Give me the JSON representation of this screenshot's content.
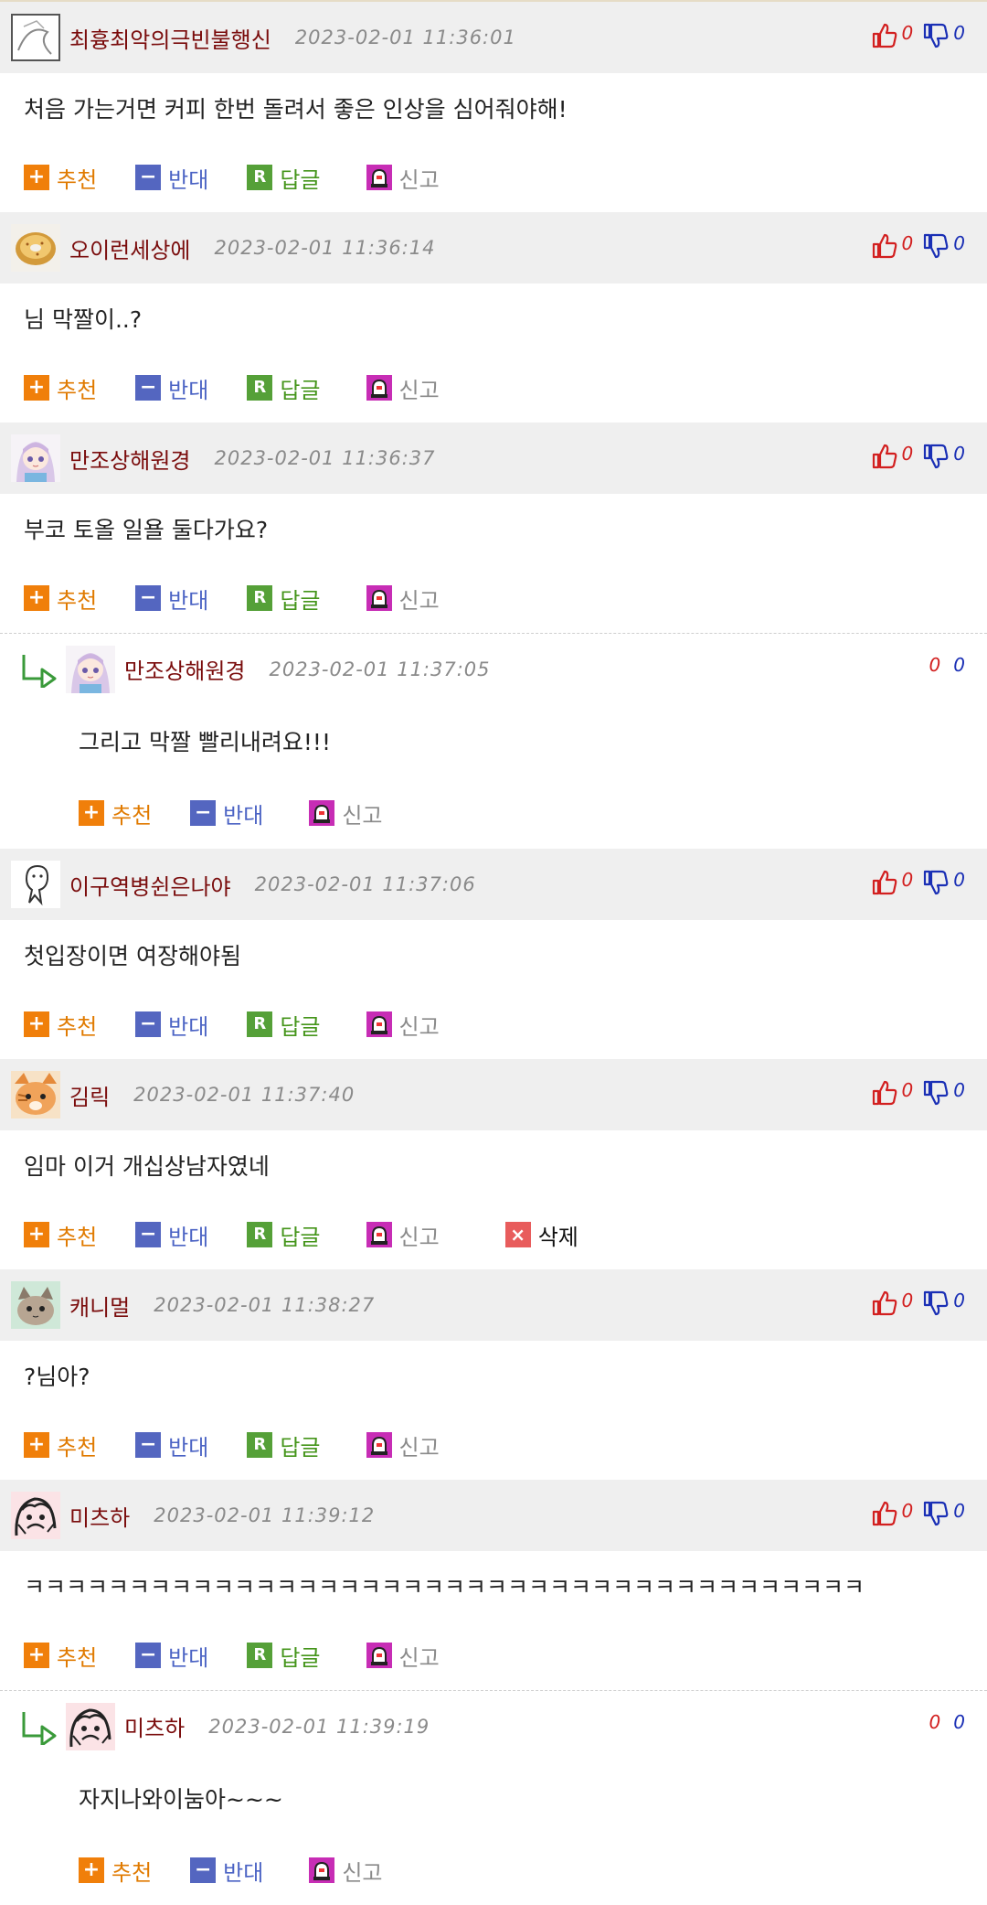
{
  "labels": {
    "recommend": "추천",
    "oppose": "반대",
    "reply": "답글",
    "report": "신고",
    "delete": "삭제",
    "recommend_icon": "+",
    "oppose_icon": "−",
    "reply_icon": "R",
    "delete_icon": "×"
  },
  "colors": {
    "nickname": "#7a0c0c",
    "header_bg": "#efefef",
    "recommend": "#f07f0a",
    "oppose": "#5466c0",
    "reply": "#55a038",
    "report": "#c72db5",
    "delete": "#e85c5c",
    "up_count": "#d21f1f",
    "down_count": "#1a2fb5"
  },
  "comments": [
    {
      "nick": "최흉최악의극빈불행신",
      "date": "2023-02-01 11:36:01",
      "text": "처음 가는거면 커피 한번 돌려서 좋은 인상을 심어줘야해!",
      "up": "0",
      "down": "0",
      "reply": false,
      "avatar": "sketch-icon",
      "can_delete": false
    },
    {
      "nick": "오이런세상에",
      "date": "2023-02-01 11:36:14",
      "text": "님 막짤이..?",
      "up": "0",
      "down": "0",
      "reply": false,
      "avatar": "donut-icon",
      "can_delete": false
    },
    {
      "nick": "만조상해원경",
      "date": "2023-02-01 11:36:37",
      "text": "부코 토올 일욜 둘다가요?",
      "up": "0",
      "down": "0",
      "reply": false,
      "avatar": "anime-girl-icon",
      "can_delete": false
    },
    {
      "nick": "만조상해원경",
      "date": "2023-02-01 11:37:05",
      "text": "그리고 막짤 빨리내려요!!!",
      "up": "0",
      "down": "0",
      "reply": true,
      "avatar": "anime-girl-icon",
      "can_delete": false
    },
    {
      "nick": "이구역병쉰은나야",
      "date": "2023-02-01 11:37:06",
      "text": "첫입장이면 여장해야됨",
      "up": "0",
      "down": "0",
      "reply": false,
      "avatar": "ghost-icon",
      "can_delete": false
    },
    {
      "nick": "김릭",
      "date": "2023-02-01 11:37:40",
      "text": "임마 이거 개십상남자였네",
      "up": "0",
      "down": "0",
      "reply": false,
      "avatar": "cat-icon",
      "can_delete": true
    },
    {
      "nick": "캐니멀",
      "date": "2023-02-01 11:38:27",
      "text": "?님아?",
      "up": "0",
      "down": "0",
      "reply": false,
      "avatar": "cat-mint-icon",
      "can_delete": false
    },
    {
      "nick": "미츠하",
      "date": "2023-02-01 11:39:12",
      "text": "ㅋㅋㅋㅋㅋㅋㅋㅋㅋㅋㅋㅋㅋㅋㅋㅋㅋㅋㅋㅋㅋㅋㅋㅋㅋㅋㅋㅋㅋㅋㅋㅋㅋㅋㅋㅋㅋㅋㅋㅋ",
      "up": "0",
      "down": "0",
      "reply": false,
      "avatar": "sketch-face-icon",
      "can_delete": false
    },
    {
      "nick": "미츠하",
      "date": "2023-02-01 11:39:19",
      "text": "자지나와이눔아~~~",
      "up": "0",
      "down": "0",
      "reply": true,
      "avatar": "sketch-face-icon",
      "can_delete": false
    }
  ]
}
